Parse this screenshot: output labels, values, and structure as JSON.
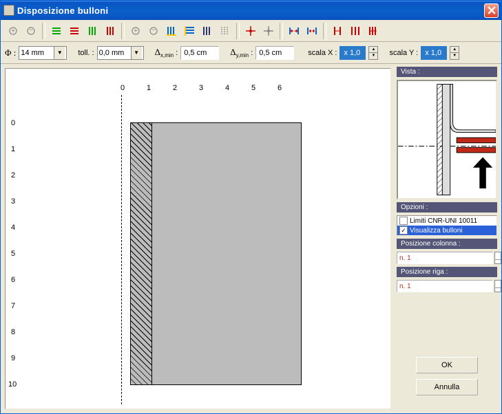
{
  "window": {
    "title": "Disposizione bulloni"
  },
  "params": {
    "phi_label": "Φ :",
    "phi_value": "14 mm",
    "toll_label": "toll. :",
    "toll_value": "0,0 mm",
    "dxmin_label_pre": "Δ",
    "dxmin_label_sub": "x,min",
    "dxmin_value": "0,5 cm",
    "dymin_label_pre": "Δ",
    "dymin_label_sub": "y,min",
    "dymin_value": "0,5 cm",
    "scalax_label": "scala X :",
    "scalax_value": "x 1,0",
    "scalay_label": "scala Y :",
    "scalay_value": "x 1,0"
  },
  "axis": {
    "x": [
      "0",
      "1",
      "2",
      "3",
      "4",
      "5",
      "6"
    ],
    "y": [
      "0",
      "1",
      "2",
      "3",
      "4",
      "5",
      "6",
      "7",
      "8",
      "9",
      "10"
    ]
  },
  "side": {
    "vista_label": "Vista :",
    "opzioni_label": "Opzioni :",
    "opt1": "Limiti CNR-UNI 10011",
    "opt2": "Visualizza bulloni",
    "col_label": "Posizione colonna :",
    "col_value": "n. 1",
    "riga_label": "Posizione riga :",
    "riga_value": "n. 1",
    "ed": "..."
  },
  "buttons": {
    "ok": "OK",
    "cancel": "Annulla"
  }
}
